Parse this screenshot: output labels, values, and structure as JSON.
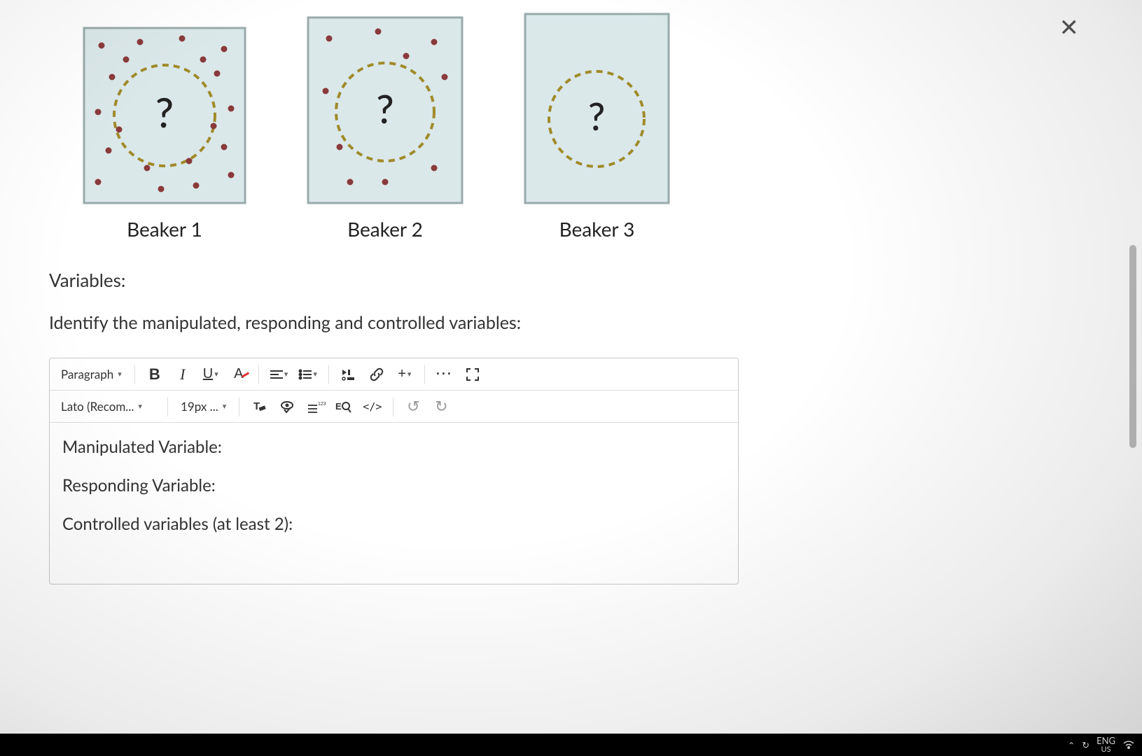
{
  "close_label": "✕",
  "beakers": [
    {
      "label": "Beaker 1",
      "question_mark": "?"
    },
    {
      "label": "Beaker 2",
      "question_mark": "?"
    },
    {
      "label": "Beaker 3",
      "question_mark": "?"
    }
  ],
  "prompt": {
    "heading": "Variables:",
    "instruction": "Identify the manipulated, responding and controlled variables:"
  },
  "editor": {
    "toolbar1": {
      "block_format": "Paragraph",
      "bold": "B",
      "italic": "I",
      "underline": "U",
      "text_color": "A",
      "align": "≡",
      "list": "≡",
      "media": "▸॥",
      "link": "🔗",
      "insert": "+",
      "more": "···",
      "fullscreen": "⛶"
    },
    "toolbar2": {
      "font_family": "Lato (Recom...",
      "font_size": "19px ...",
      "clear_format_icon": "clear-formatting",
      "accessibility_icon": "accessibility-checker",
      "superscript_icon": "superscript",
      "find_icon": "find-replace",
      "code_label": "</>",
      "undo": "↺",
      "redo": "↻"
    },
    "body": {
      "line1": "Manipulated Variable:",
      "line2": "Responding Variable:",
      "line3": "Controlled variables (at least 2):"
    }
  },
  "taskbar": {
    "lang_top": "ENG",
    "lang_bottom": "US"
  }
}
